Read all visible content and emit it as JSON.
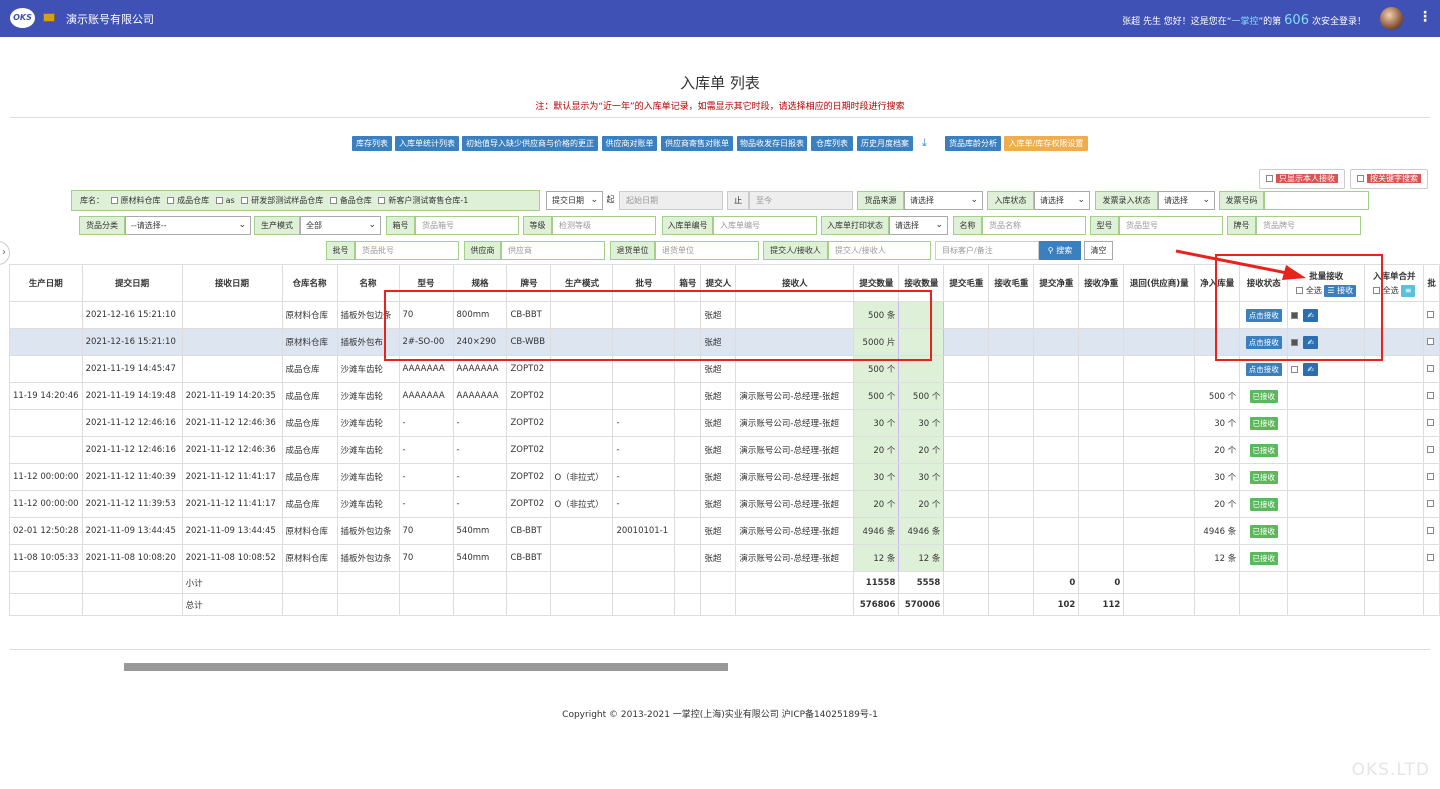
{
  "header": {
    "logo": "OKS",
    "company": "演示账号有限公司",
    "welcome_pre": "张超 先生 您好！这是您在“",
    "welcome_brand": "一掌控",
    "welcome_mid": "”的第",
    "login_count": "606",
    "welcome_post": "次安全登录！"
  },
  "page": {
    "title": "入库单 列表",
    "note": "注：默认显示为“近一年”的入库单记录，如需显示其它时段，请选择相应的日期时段进行搜索"
  },
  "nav": [
    "库存列表",
    "入库单统计列表",
    "初始值导入缺少供应商与价格的更正",
    "供应商对账单",
    "供应商寄售对账单",
    "物品收发存日报表",
    "仓库列表",
    "历史月度档案",
    "货品库龄分析",
    "入库单/库存权限设置"
  ],
  "toggles": {
    "only_mine": "只显示本人接收",
    "keyword": "按关键字搜索"
  },
  "filters": {
    "warehouse_label": "库名：",
    "warehouses": [
      "原材料仓库",
      "成品仓库",
      "as",
      "研发部测试样品仓库",
      "备品仓库",
      "新客户测试寄售仓库-1"
    ],
    "date_type": "提交日期",
    "from": "起",
    "from_ph": "起始日期",
    "to": "止",
    "to_ph": "至今",
    "source_label": "货品来源",
    "select_ph": "请选择",
    "in_status": "入库状态",
    "invoice_status": "发票录入状态",
    "invoice_no": "发票号码",
    "category": "货品分类",
    "category_ph": "--请选择--",
    "mode": "生产模式",
    "mode_val": "全部",
    "box": "箱号",
    "box_ph": "货品箱号",
    "grade": "等级",
    "grade_ph": "检测等级",
    "order_no": "入库单编号",
    "order_ph": "入库单编号",
    "print_status": "入库单打印状态",
    "name": "名称",
    "name_ph": "货品名称",
    "model": "型号",
    "model_ph": "货品型号",
    "brand": "牌号",
    "brand_ph": "货品牌号",
    "batch": "批号",
    "batch_ph": "货品批号",
    "supplier": "供应商",
    "supplier_ph": "供应商",
    "return_unit": "退货单位",
    "return_ph": "退货单位",
    "submitter": "提交人/接收人",
    "submitter_ph": "提交人/接收人",
    "target_ph": "目标客户/备注",
    "search": "搜索",
    "clear": "清空"
  },
  "table": {
    "headers": [
      "生产日期",
      "提交日期",
      "接收日期",
      "仓库名称",
      "名称",
      "型号",
      "规格",
      "牌号",
      "生产模式",
      "批号",
      "箱号",
      "提交人",
      "接收人",
      "提交数量",
      "接收数量",
      "提交毛重",
      "接收毛重",
      "提交净重",
      "接收净重",
      "退回(供应商)量",
      "净入库量",
      "接收状态",
      "批量接收",
      "入库单合并",
      "批"
    ],
    "select_all": "全选",
    "receive_btn": "接收",
    "rows": [
      {
        "prod": "",
        "submit": "2021-12-16 15:21:10",
        "recv": "",
        "wh": "原材料仓库",
        "name": "插板外包边条",
        "model": "70",
        "spec": "800mm",
        "brand": "CB-BBT",
        "mode": "",
        "batch": "",
        "box": "",
        "sub": "张超",
        "rec": "",
        "sq": "500 条",
        "rq": "",
        "net": "",
        "status": "点击接收",
        "st": "blue",
        "chk": true
      },
      {
        "prod": "",
        "submit": "2021-12-16 15:21:10",
        "recv": "",
        "wh": "原材料仓库",
        "name": "插板外包布",
        "model": "2#-SO-00",
        "spec": "240×290",
        "brand": "CB-WBB",
        "mode": "",
        "batch": "",
        "box": "",
        "sub": "张超",
        "rec": "",
        "sq": "5000 片",
        "rq": "",
        "net": "",
        "status": "点击接收",
        "st": "blue",
        "chk": true
      },
      {
        "prod": "",
        "submit": "2021-11-19 14:45:47",
        "recv": "",
        "wh": "成品仓库",
        "name": "沙滩车齿轮",
        "model": "AAAAAAA",
        "spec": "AAAAAAA",
        "brand": "ZOPT02",
        "mode": "",
        "batch": "",
        "box": "",
        "sub": "张超",
        "rec": "",
        "sq": "500 个",
        "rq": "",
        "net": "",
        "status": "点击接收",
        "st": "blue",
        "chk": false
      },
      {
        "prod": "11-19 14:20:46",
        "submit": "2021-11-19 14:19:48",
        "recv": "2021-11-19 14:20:35",
        "wh": "成品仓库",
        "name": "沙滩车齿轮",
        "model": "AAAAAAA",
        "spec": "AAAAAAA",
        "brand": "ZOPT02",
        "mode": "",
        "batch": "",
        "box": "",
        "sub": "张超",
        "rec": "演示账号公司-总经理-张超",
        "sq": "500 个",
        "rq": "500 个",
        "net": "500 个",
        "status": "已接收",
        "st": "green"
      },
      {
        "prod": "",
        "submit": "2021-11-12 12:46:16",
        "recv": "2021-11-12 12:46:36",
        "wh": "成品仓库",
        "name": "沙滩车齿轮",
        "model": "-",
        "spec": "-",
        "brand": "ZOPT02",
        "mode": "",
        "batch": "-",
        "box": "",
        "sub": "张超",
        "rec": "演示账号公司-总经理-张超",
        "sq": "30 个",
        "rq": "30 个",
        "net": "30 个",
        "status": "已接收",
        "st": "green"
      },
      {
        "prod": "",
        "submit": "2021-11-12 12:46:16",
        "recv": "2021-11-12 12:46:36",
        "wh": "成品仓库",
        "name": "沙滩车齿轮",
        "model": "-",
        "spec": "-",
        "brand": "ZOPT02",
        "mode": "",
        "batch": "-",
        "box": "",
        "sub": "张超",
        "rec": "演示账号公司-总经理-张超",
        "sq": "20 个",
        "rq": "20 个",
        "net": "20 个",
        "status": "已接收",
        "st": "green"
      },
      {
        "prod": "11-12 00:00:00",
        "submit": "2021-11-12 11:40:39",
        "recv": "2021-11-12 11:41:17",
        "wh": "成品仓库",
        "name": "沙滩车齿轮",
        "model": "-",
        "spec": "-",
        "brand": "ZOPT02",
        "mode": "O（非拉式）",
        "batch": "-",
        "box": "",
        "sub": "张超",
        "rec": "演示账号公司-总经理-张超",
        "sq": "30 个",
        "rq": "30 个",
        "net": "30 个",
        "status": "已接收",
        "st": "green"
      },
      {
        "prod": "11-12 00:00:00",
        "submit": "2021-11-12 11:39:53",
        "recv": "2021-11-12 11:41:17",
        "wh": "成品仓库",
        "name": "沙滩车齿轮",
        "model": "-",
        "spec": "-",
        "brand": "ZOPT02",
        "mode": "O（非拉式）",
        "batch": "-",
        "box": "",
        "sub": "张超",
        "rec": "演示账号公司-总经理-张超",
        "sq": "20 个",
        "rq": "20 个",
        "net": "20 个",
        "status": "已接收",
        "st": "green"
      },
      {
        "prod": "02-01 12:50:28",
        "submit": "2021-11-09 13:44:45",
        "recv": "2021-11-09 13:44:45",
        "wh": "原材料仓库",
        "name": "插板外包边条",
        "model": "70",
        "spec": "540mm",
        "brand": "CB-BBT",
        "mode": "",
        "batch": "20010101-1",
        "box": "",
        "sub": "张超",
        "rec": "演示账号公司-总经理-张超",
        "sq": "4946 条",
        "rq": "4946 条",
        "net": "4946 条",
        "status": "已接收",
        "st": "green"
      },
      {
        "prod": "11-08 10:05:33",
        "submit": "2021-11-08 10:08:20",
        "recv": "2021-11-08 10:08:52",
        "wh": "原材料仓库",
        "name": "插板外包边条",
        "model": "70",
        "spec": "540mm",
        "brand": "CB-BBT",
        "mode": "",
        "batch": "",
        "box": "",
        "sub": "张超",
        "rec": "演示账号公司-总经理-张超",
        "sq": "12 条",
        "rq": "12 条",
        "net": "12 条",
        "status": "已接收",
        "st": "green"
      }
    ],
    "subtotal": {
      "label": "小计",
      "sq": "11558",
      "rq": "5558",
      "snet": "0",
      "rnet": "0"
    },
    "total": {
      "label": "总计",
      "sq": "576806",
      "rq": "570006",
      "snet": "102",
      "rnet": "112"
    }
  },
  "footer": {
    "copyright": "Copyright © 2013-2021 一掌控(上海)实业有限公司 沪ICP备14025189号-1",
    "watermark": "OKS.LTD"
  }
}
